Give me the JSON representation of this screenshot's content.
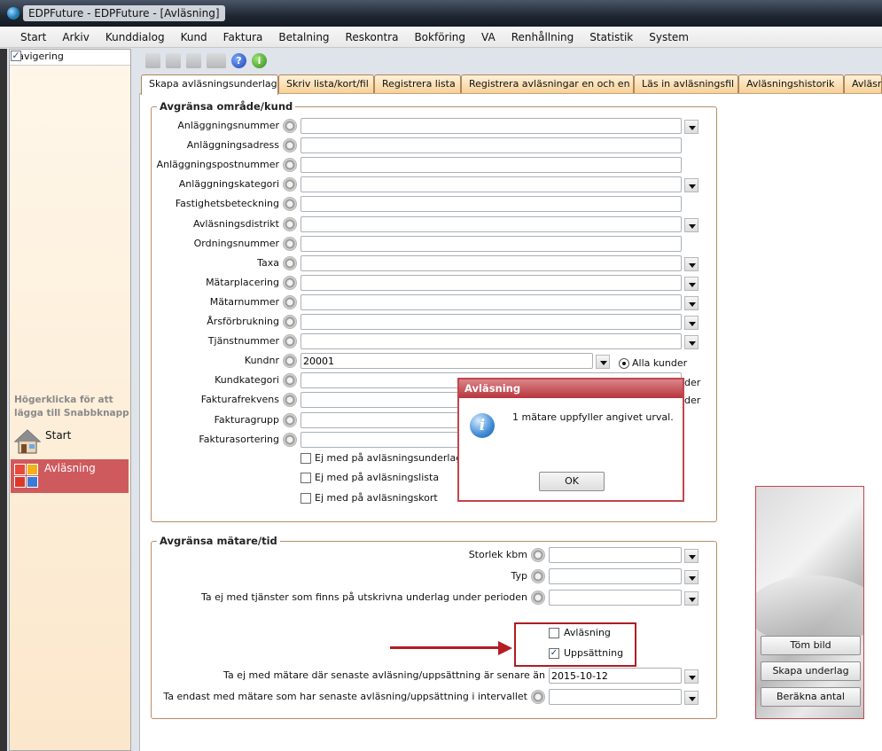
{
  "window": {
    "title": "EDPFuture - EDPFuture - [Avläsning]"
  },
  "menu": [
    "Start",
    "Arkiv",
    "Kunddialog",
    "Kund",
    "Faktura",
    "Betalning",
    "Reskontra",
    "Bokföring",
    "VA",
    "Renhållning",
    "Statistik",
    "System"
  ],
  "nav": {
    "header": "Navigering",
    "hint": "Högerklicka för att lägga till Snabbknapp",
    "items": [
      {
        "label": "Start",
        "icon": "house-icon"
      },
      {
        "label": "Avläsning",
        "icon": "tiles-icon",
        "active": true
      }
    ]
  },
  "toolbar": {
    "icons": [
      "back-icon",
      "print-icon",
      "preview-icon",
      "export-icon",
      "help-icon",
      "info-icon"
    ],
    "help_glyph": "?",
    "info_glyph": "i"
  },
  "tabs": [
    "Skapa avläsningsunderlag",
    "Skriv lista/kort/fil",
    "Registrera lista",
    "Registrera avläsningar en och en",
    "Läs in avläsningsfil",
    "Avläsningshistorik",
    "Avläsn"
  ],
  "group1": {
    "title": "Avgränsa område/kund",
    "fields": [
      {
        "label": "Anläggningsnummer",
        "value": "",
        "dropdown": true
      },
      {
        "label": "Anläggningsadress",
        "value": "",
        "dropdown": false
      },
      {
        "label": "Anläggningspostnummer",
        "value": "",
        "dropdown": false
      },
      {
        "label": "Anläggningskategori",
        "value": "",
        "dropdown": true
      },
      {
        "label": "Fastighetsbeteckning",
        "value": "",
        "dropdown": false
      },
      {
        "label": "Avläsningsdistrikt",
        "value": "",
        "dropdown": true
      },
      {
        "label": "Ordningsnummer",
        "value": "",
        "dropdown": false
      },
      {
        "label": "Taxa",
        "value": "",
        "dropdown": true
      },
      {
        "label": "Mätarplacering",
        "value": "",
        "dropdown": true
      },
      {
        "label": "Mätarnummer",
        "value": "",
        "dropdown": true
      },
      {
        "label": "Årsförbrukning",
        "value": "",
        "dropdown": true
      },
      {
        "label": "Tjänstnummer",
        "value": "",
        "dropdown": true
      },
      {
        "label": "Kundnr",
        "value": "20001",
        "dropdown": true
      },
      {
        "label": "Kundkategori",
        "value": "",
        "dropdown": false
      },
      {
        "label": "Fakturafrekvens",
        "value": "",
        "dropdown": false
      },
      {
        "label": "Fakturagrupp",
        "value": "",
        "dropdown": false
      },
      {
        "label": "Fakturasortering",
        "value": "",
        "dropdown": false
      }
    ],
    "radios": [
      {
        "label": "Alla kunder",
        "selected": true
      },
      {
        "label": "der",
        "selected": false
      },
      {
        "label": "der",
        "selected": false
      }
    ],
    "checkboxes": [
      {
        "label": "Ej med på avläsningsunderlag",
        "checked": false
      },
      {
        "label": "Ej med på avläsningslista",
        "checked": false
      },
      {
        "label": "Ej med på avläsningskort",
        "checked": false
      }
    ]
  },
  "group2": {
    "title": "Avgränsa mätare/tid",
    "fields": [
      {
        "label": "Storlek kbm",
        "value": ""
      },
      {
        "label": "Typ",
        "value": ""
      },
      {
        "label": "Ta ej med tjänster som finns på utskrivna underlag under perioden",
        "value": ""
      }
    ],
    "checkboxes": [
      {
        "label": "Avläsning",
        "checked": false
      },
      {
        "label": "Uppsättning",
        "checked": true
      }
    ],
    "date_field": {
      "label": "Ta ej med mätare där senaste avläsning/uppsättning är senare än",
      "value": "2015-10-12"
    },
    "interval_field": {
      "label": "Ta endast med mätare som har senaste avläsning/uppsättning i intervallet",
      "value": ""
    }
  },
  "dialog": {
    "title": "Avläsning",
    "message": "1 mätare uppfyller angivet urval.",
    "ok_label": "OK",
    "icon_glyph": "i"
  },
  "side_buttons": [
    "Töm bild",
    "Skapa underlag",
    "Beräkna antal"
  ],
  "colors": {
    "accent": "#c3454b",
    "nav_active": "#cf5a5e",
    "tab_bg": "#f5cf94"
  }
}
